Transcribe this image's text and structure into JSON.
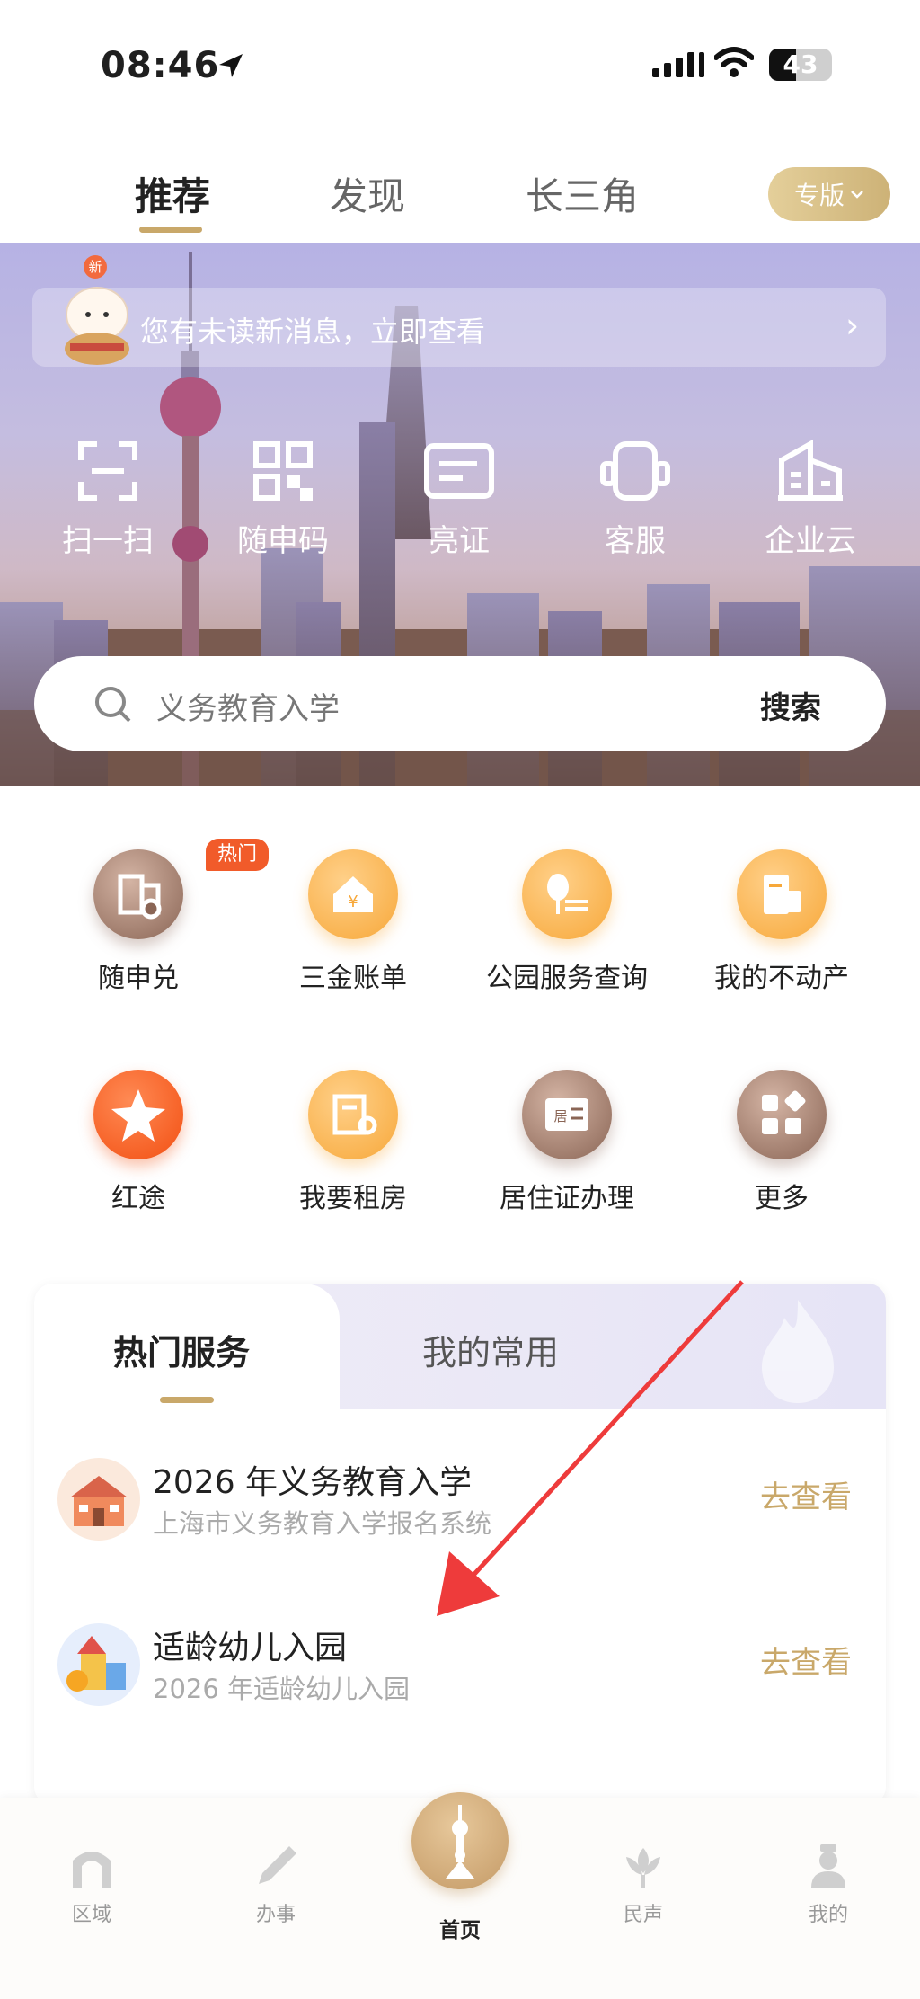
{
  "status_bar": {
    "time": "08:46",
    "battery": "43"
  },
  "top_tabs": {
    "items": [
      "推荐",
      "发现",
      "长三角"
    ],
    "active": "推荐",
    "edition_label": "专版"
  },
  "hero": {
    "notice_badge": "新",
    "notice_text": "您有未读新消息，立即查看",
    "quick_actions": [
      {
        "label": "扫一扫",
        "icon": "scan-icon"
      },
      {
        "label": "随申码",
        "icon": "qr-code-icon"
      },
      {
        "label": "亮证",
        "icon": "id-card-icon"
      },
      {
        "label": "客服",
        "icon": "headset-icon"
      },
      {
        "label": "企业云",
        "icon": "building-icon"
      }
    ],
    "search_placeholder": "义务教育入学",
    "search_button": "搜索"
  },
  "services": {
    "hot_badge": "热门",
    "items": [
      {
        "label": "随申兑",
        "icon": "coupon-building-icon",
        "color": "brown"
      },
      {
        "label": "三金账单",
        "icon": "house-yuan-icon",
        "color": "orange"
      },
      {
        "label": "公园服务查询",
        "icon": "tree-bench-icon",
        "color": "orange"
      },
      {
        "label": "我的不动产",
        "icon": "property-doc-icon",
        "color": "orange"
      },
      {
        "label": "红途",
        "icon": "star-icon",
        "color": "red"
      },
      {
        "label": "我要租房",
        "icon": "rent-house-icon",
        "color": "orange"
      },
      {
        "label": "居住证办理",
        "icon": "residence-card-icon",
        "color": "brown"
      },
      {
        "label": "更多",
        "icon": "grid-more-icon",
        "color": "brown"
      }
    ]
  },
  "hot_services": {
    "tabs": [
      "热门服务",
      "我的常用"
    ],
    "active_tab": "热门服务",
    "items": [
      {
        "title": "2026 年义务教育入学",
        "subtitle": "上海市义务教育入学报名系统",
        "action": "去查看",
        "icon": "school-building-icon"
      },
      {
        "title": "适龄幼儿入园",
        "subtitle": "2026 年适龄幼儿入园",
        "action": "去查看",
        "icon": "toy-castle-icon"
      }
    ]
  },
  "bottom_nav": {
    "items": [
      {
        "label": "区域",
        "icon": "arch-icon"
      },
      {
        "label": "办事",
        "icon": "pen-icon"
      },
      {
        "label": "首页",
        "icon": "tower-icon"
      },
      {
        "label": "民声",
        "icon": "flower-icon"
      },
      {
        "label": "我的",
        "icon": "person-icon"
      }
    ],
    "active": "首页"
  },
  "colors": {
    "accent_gold": "#c9a86a",
    "hot_red": "#f15b2a",
    "arrow_red": "#ee3b3b"
  }
}
